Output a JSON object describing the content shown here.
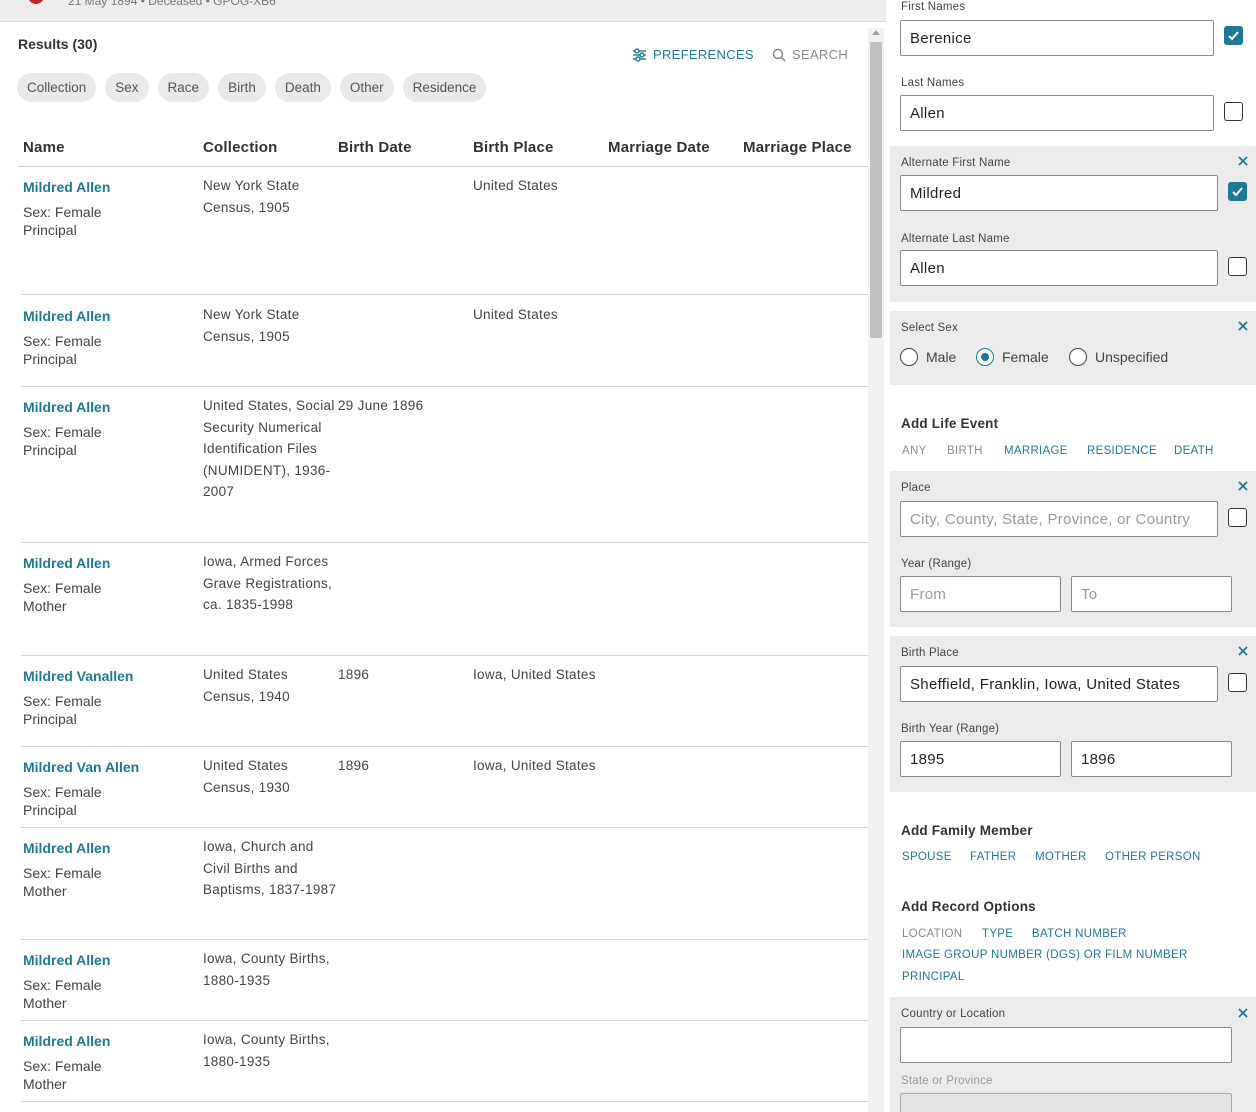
{
  "top": {
    "subline": "21 May 1894 • Deceased • GPOG-XB6"
  },
  "results": {
    "title": "Results (30)",
    "preferences_label": "PREFERENCES",
    "search_label": "SEARCH",
    "chips": [
      "Collection",
      "Sex",
      "Race",
      "Birth",
      "Death",
      "Other",
      "Residence"
    ],
    "columns": [
      "Name",
      "Collection",
      "Birth Date",
      "Birth Place",
      "Marriage Date",
      "Marriage Place"
    ],
    "rows": [
      {
        "name": "Mildred Allen",
        "sex": "Sex: Female",
        "role": "Principal",
        "collection": "New York State Census, 1905",
        "birth_date": "",
        "birth_place": "United States"
      },
      {
        "name": "Mildred Allen",
        "sex": "Sex: Female",
        "role": "Principal",
        "collection": "New York State Census, 1905",
        "birth_date": "",
        "birth_place": "United States"
      },
      {
        "name": "Mildred Allen",
        "sex": "Sex: Female",
        "role": "Principal",
        "collection": "United States, Social Security Numerical Identification Files (NUMIDENT), 1936-2007",
        "birth_date": "29 June 1896",
        "birth_place": ""
      },
      {
        "name": "Mildred Allen",
        "sex": "Sex: Female",
        "role": "Mother",
        "collection": "Iowa, Armed Forces Grave Registrations, ca. 1835-1998",
        "birth_date": "",
        "birth_place": ""
      },
      {
        "name": "Mildred Vanallen",
        "sex": "Sex: Female",
        "role": "Principal",
        "collection": "United States Census, 1940",
        "birth_date": "1896",
        "birth_place": "Iowa, United States"
      },
      {
        "name": "Mildred Van Allen",
        "sex": "Sex: Female",
        "role": "Principal",
        "collection": "United States Census, 1930",
        "birth_date": "1896",
        "birth_place": "Iowa, United States"
      },
      {
        "name": "Mildred Allen",
        "sex": "Sex: Female",
        "role": "Mother",
        "collection": "Iowa, Church and Civil Births and Baptisms, 1837-1987",
        "birth_date": "",
        "birth_place": ""
      },
      {
        "name": "Mildred Allen",
        "sex": "Sex: Female",
        "role": "Mother",
        "collection": "Iowa, County Births, 1880-1935",
        "birth_date": "",
        "birth_place": ""
      },
      {
        "name": "Mildred Allen",
        "sex": "Sex: Female",
        "role": "Mother",
        "collection": "Iowa, County Births, 1880-1935",
        "birth_date": "",
        "birth_place": ""
      }
    ]
  },
  "form": {
    "first_names": {
      "label": "First Names",
      "value": "Berenice",
      "exact": true
    },
    "last_names": {
      "label": "Last Names",
      "value": "Allen",
      "exact": false
    },
    "alt_first": {
      "label": "Alternate First Name",
      "value": "Mildred",
      "exact": true
    },
    "alt_last": {
      "label": "Alternate Last Name",
      "value": "Allen",
      "exact": false
    },
    "sex": {
      "label": "Select Sex",
      "options": [
        "Male",
        "Female",
        "Unspecified"
      ],
      "selected": "Female"
    },
    "life_event": {
      "title": "Add Life Event",
      "tabs": [
        "ANY",
        "BIRTH",
        "MARRIAGE",
        "RESIDENCE",
        "DEATH"
      ],
      "place_label": "Place",
      "place_placeholder": "City, County, State, Province, or Country",
      "year_label": "Year (Range)",
      "from_placeholder": "From",
      "to_placeholder": "To"
    },
    "birth": {
      "place_label": "Birth Place",
      "place_value": "Sheffield, Franklin, Iowa, United States",
      "year_label": "Birth Year (Range)",
      "year_from": "1895",
      "year_to": "1896"
    },
    "family": {
      "title": "Add Family Member",
      "links": [
        "SPOUSE",
        "FATHER",
        "MOTHER",
        "OTHER PERSON"
      ]
    },
    "record_options": {
      "title": "Add Record Options",
      "location": "LOCATION",
      "type": "TYPE",
      "batch": "BATCH NUMBER",
      "image_group": "IMAGE GROUP NUMBER (DGS) OR FILM NUMBER",
      "principal": "PRINCIPAL"
    },
    "country": {
      "label": "Country or Location",
      "value": ""
    },
    "state": {
      "label": "State or Province"
    }
  },
  "colors": {
    "accent": "#1e7896",
    "panel_grey": "#ebebeb",
    "brand_red": "#c1272d"
  }
}
